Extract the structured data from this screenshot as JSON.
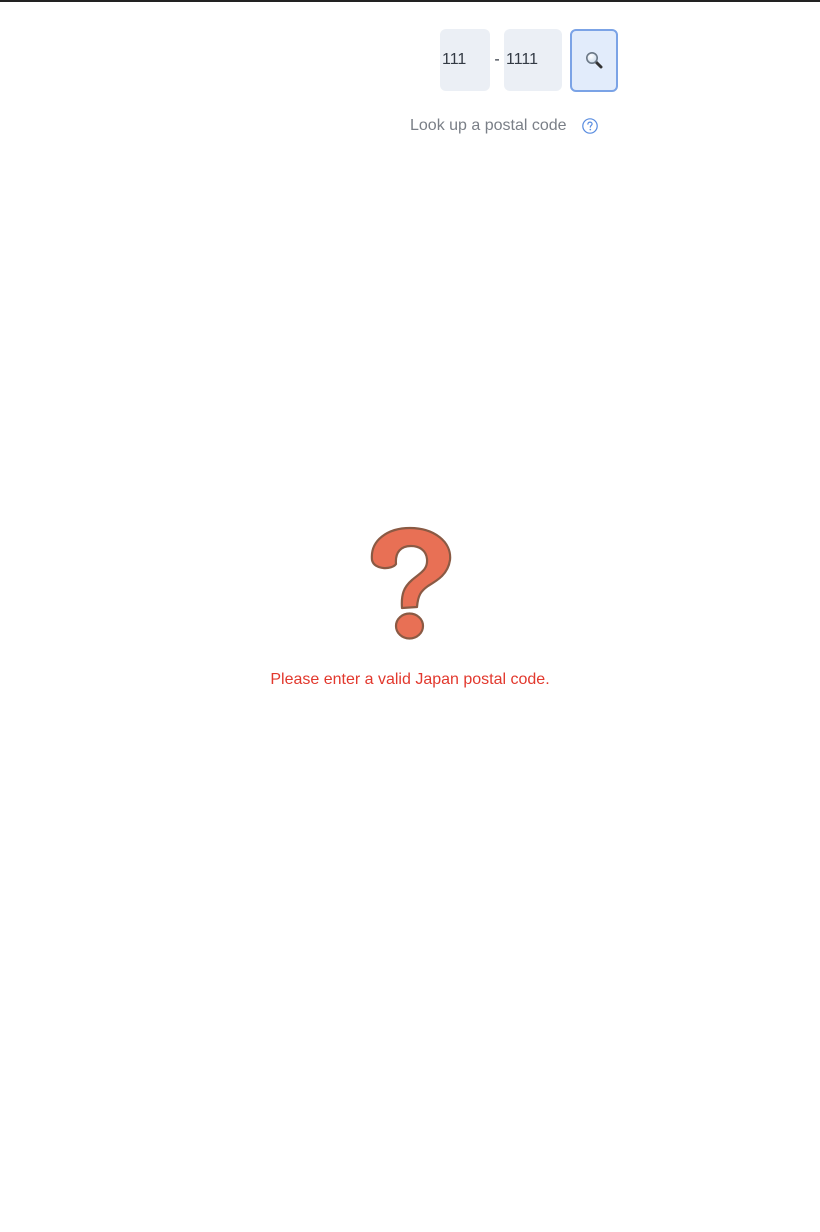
{
  "postal_form": {
    "first_part_value": "111",
    "separator": "-",
    "second_part_value": "1111",
    "search_icon": "magnifying-glass-icon"
  },
  "lookup": {
    "link_label": "Look up a postal code",
    "help_icon": "question-circle-icon"
  },
  "result": {
    "icon": "red-question-mark-icon",
    "error_message": "Please enter a valid Japan postal code."
  },
  "colors": {
    "error_text": "#e2382d",
    "question_mark_fill": "#e87055",
    "question_mark_stroke": "#8a5a44",
    "help_icon": "#5a8de0",
    "button_border": "#7ba3e6",
    "input_background": "#ebeff5"
  }
}
